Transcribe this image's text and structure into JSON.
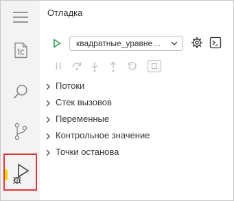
{
  "panel": {
    "title": "Отладка"
  },
  "activity_bar": {
    "items": [
      {
        "icon": "hamburger-menu-icon"
      },
      {
        "icon": "1c-file-icon"
      },
      {
        "icon": "search-icon"
      },
      {
        "icon": "source-control-icon"
      },
      {
        "icon": "run-debug-icon",
        "selected": true
      }
    ],
    "selection_outline_color": "#e0383a",
    "active_marker_color": "#f3d400"
  },
  "run_bar": {
    "configuration": "квадратные_уравнения",
    "run_icon_color": "#2e9e4f"
  },
  "debug_toolbar": {
    "buttons": [
      "pause-icon",
      "step-over-icon",
      "step-into-icon",
      "step-out-icon",
      "restart-icon",
      "stop-icon"
    ]
  },
  "sections": [
    {
      "label": "Потоки"
    },
    {
      "label": "Стек вызовов"
    },
    {
      "label": "Переменные"
    },
    {
      "label": "Контрольное значение"
    },
    {
      "label": "Точки останова"
    }
  ]
}
